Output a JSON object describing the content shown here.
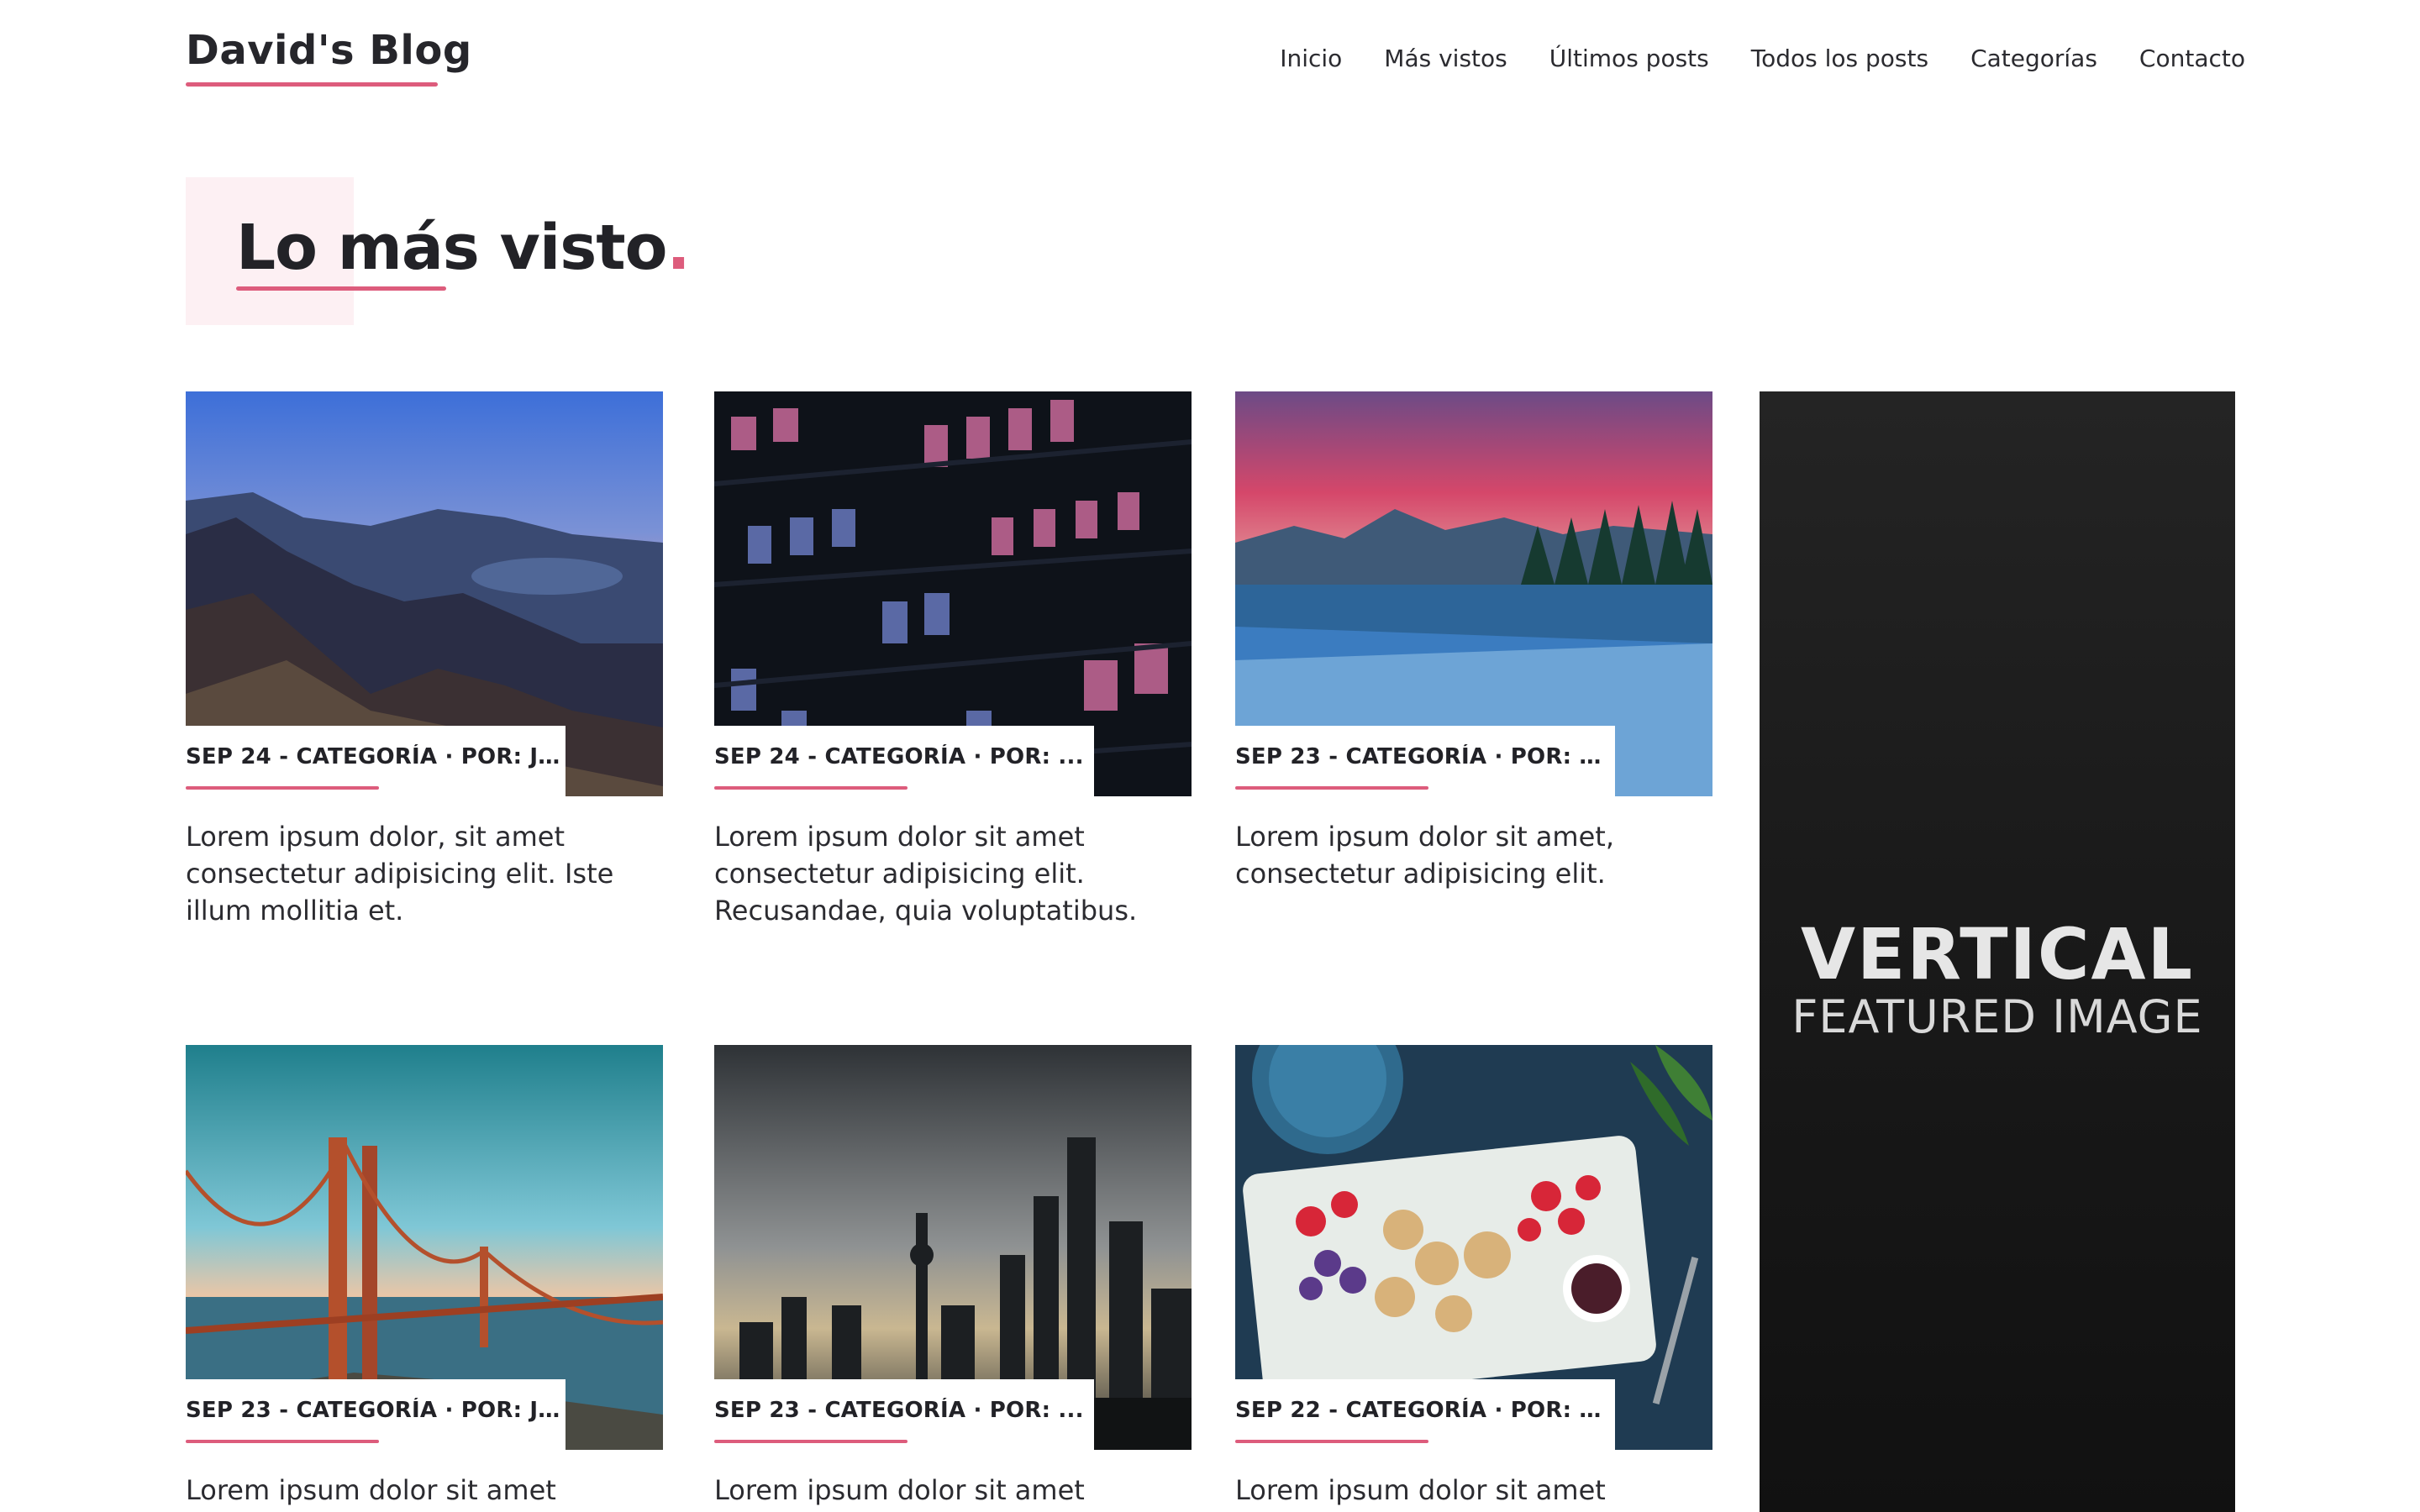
{
  "header": {
    "brand": "David's Blog",
    "nav": [
      "Inicio",
      "Más vistos",
      "Últimos posts",
      "Todos los posts",
      "Categorías",
      "Contacto"
    ]
  },
  "section": {
    "title": "Lo más visto",
    "dot": "."
  },
  "posts": [
    {
      "meta": "SEP 24 - CATEGORÍA · POR:  J...",
      "excerpt": "Lorem ipsum dolor, sit amet consectetur adipisicing elit. Iste illum mollitia et.",
      "image": "mountain-valley-dusk"
    },
    {
      "meta": "SEP 24 - CATEGORÍA · POR:  ...",
      "excerpt": "Lorem ipsum dolor sit amet consectetur adipisicing elit. Recusandae, quia voluptatibus.",
      "image": "office-building-night"
    },
    {
      "meta": "SEP 23 - CATEGORÍA · POR:  T...",
      "excerpt": "Lorem ipsum dolor sit amet, consectetur adipisicing elit.",
      "image": "mountain-lake-sunset"
    },
    {
      "meta": "SEP 23 - CATEGORÍA · POR:  J...",
      "excerpt": "Lorem ipsum dolor sit amet",
      "image": "golden-gate-bridge"
    },
    {
      "meta": "SEP 23 - CATEGORÍA · POR:  ...",
      "excerpt": "Lorem ipsum dolor sit amet",
      "image": "city-skyline-dusk"
    },
    {
      "meta": "SEP 22 - CATEGORÍA · POR:  E...",
      "excerpt": "Lorem ipsum dolor sit amet",
      "image": "food-platter"
    }
  ],
  "featured": {
    "title": "VERTICAL",
    "subtitle": "FEATURED IMAGE"
  },
  "colors": {
    "accent": "#dd5c7c",
    "heading_bg": "#fdf0f3",
    "text": "#222227"
  }
}
